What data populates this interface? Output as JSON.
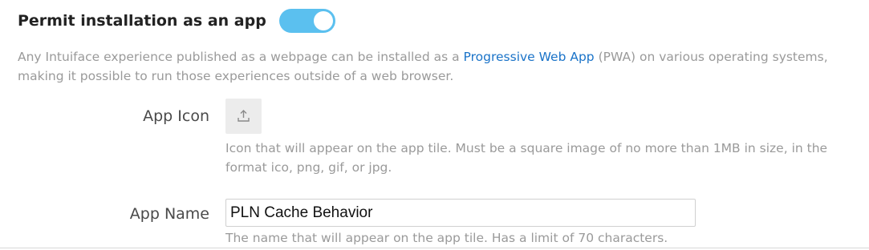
{
  "pwa_section": {
    "title": "Permit installation as an app",
    "toggle_enabled": true,
    "description_before": "Any Intuiface experience published as a webpage can be installed as a ",
    "description_link": "Progressive Web App",
    "description_after": " (PWA) on various operating systems, making it possible to run those experiences outside of a web browser."
  },
  "app_icon": {
    "label": "App Icon",
    "upload_icon": "upload-icon",
    "hint": "Icon that will appear on the app tile. Must be a square image of no more than 1MB in size, in the format ico, png, gif, or jpg."
  },
  "app_name": {
    "label": "App Name",
    "value": "PLN Cache Behavior",
    "hint": "The name that will appear on the app tile. Has a limit of 70 characters."
  },
  "colors": {
    "toggle_on": "#5bc0ef",
    "link": "#1a73c8",
    "muted_text": "#9a9a9a"
  }
}
